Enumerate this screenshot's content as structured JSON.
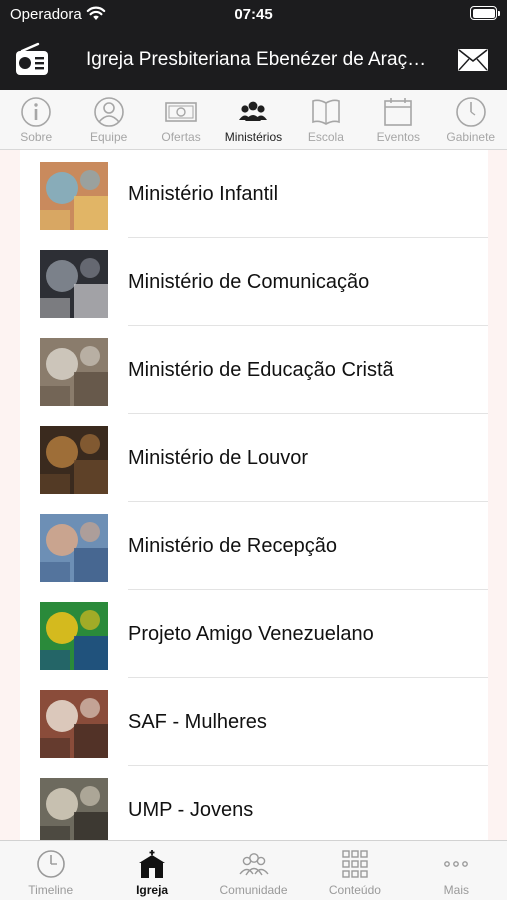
{
  "status_bar": {
    "carrier": "Operadora",
    "time": "07:45"
  },
  "nav": {
    "title": "Igreja Presbiteriana Ebenézer de Araçatuba",
    "left_icon": "radio-icon",
    "right_icon": "mail-icon"
  },
  "top_tabs": [
    {
      "label": "Sobre",
      "icon": "info-icon",
      "active": false
    },
    {
      "label": "Equipe",
      "icon": "person-icon",
      "active": false
    },
    {
      "label": "Ofertas",
      "icon": "money-icon",
      "active": false
    },
    {
      "label": "Ministérios",
      "icon": "group-icon",
      "active": true
    },
    {
      "label": "Escola",
      "icon": "book-icon",
      "active": false
    },
    {
      "label": "Eventos",
      "icon": "calendar-icon",
      "active": false
    },
    {
      "label": "Gabinete",
      "icon": "clock-icon",
      "active": false
    }
  ],
  "ministries": [
    {
      "name": "Ministério Infantil",
      "colors": [
        "#c98a5d",
        "#7cb1c9",
        "#e8c36a"
      ]
    },
    {
      "name": "Ministério de Comunicação",
      "colors": [
        "#2d2f35",
        "#8a8f99",
        "#c9c9cc"
      ]
    },
    {
      "name": "Ministério de Educação Cristã",
      "colors": [
        "#8a7c6c",
        "#d7d2c8",
        "#5b4d40"
      ]
    },
    {
      "name": "Ministério de Louvor",
      "colors": [
        "#3a2a1e",
        "#b07a3d",
        "#6b4a2c"
      ]
    },
    {
      "name": "Ministério de Recepção",
      "colors": [
        "#6d8fb5",
        "#d9a888",
        "#3b5a86"
      ]
    },
    {
      "name": "Projeto Amigo Venezuelano",
      "colors": [
        "#2a8a3a",
        "#f2c21a",
        "#1d3f93"
      ]
    },
    {
      "name": "SAF - Mulheres",
      "colors": [
        "#8a4c3a",
        "#e9ded2",
        "#3f2a22"
      ]
    },
    {
      "name": "UMP - Jovens",
      "colors": [
        "#6d6a5e",
        "#d7cfbe",
        "#2e2a24"
      ]
    }
  ],
  "bottom_tabs": [
    {
      "label": "Timeline",
      "icon": "clock-icon",
      "active": false
    },
    {
      "label": "Igreja",
      "icon": "church-icon",
      "active": true
    },
    {
      "label": "Comunidade",
      "icon": "people-icon",
      "active": false
    },
    {
      "label": "Conteúdo",
      "icon": "grid-icon",
      "active": false
    },
    {
      "label": "Mais",
      "icon": "more-icon",
      "active": false
    }
  ]
}
